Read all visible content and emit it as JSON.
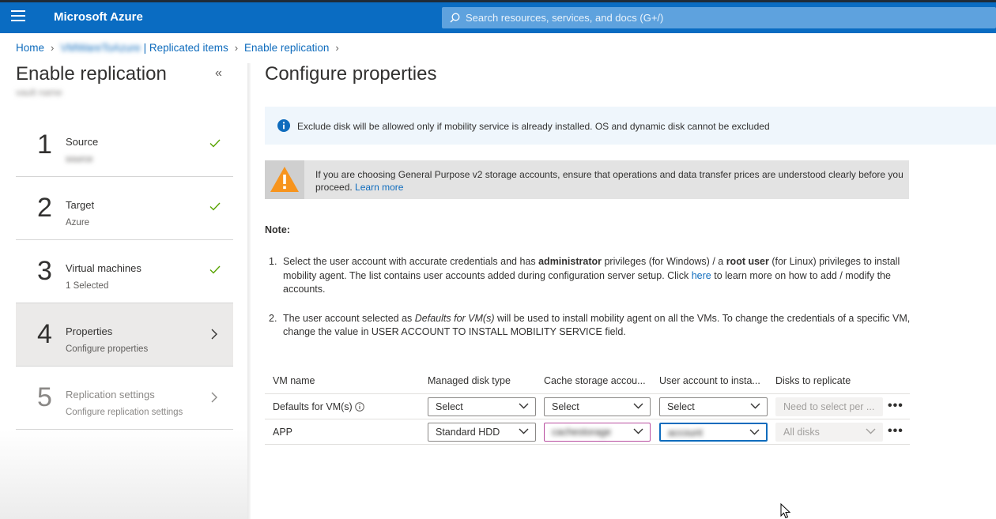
{
  "topbar": {
    "brand": "Microsoft Azure",
    "search_placeholder": "Search resources, services, and docs (G+/)"
  },
  "breadcrumb": {
    "home": "Home",
    "vault_blurred": "VMWareToAzure",
    "replicated_items": " | Replicated items",
    "enable_replication": "Enable replication"
  },
  "left": {
    "title": "Enable replication",
    "subtitle_blurred": "vault name",
    "steps": [
      {
        "num": "1",
        "title": "Source",
        "sub": "source",
        "state": "done"
      },
      {
        "num": "2",
        "title": "Target",
        "sub": "Azure",
        "state": "done"
      },
      {
        "num": "3",
        "title": "Virtual machines",
        "sub": "1 Selected",
        "state": "done"
      },
      {
        "num": "4",
        "title": "Properties",
        "sub": "Configure properties",
        "state": "active"
      },
      {
        "num": "5",
        "title": "Replication settings",
        "sub": "Configure replication settings",
        "state": "disabled"
      }
    ]
  },
  "main": {
    "title": "Configure properties",
    "info": "Exclude disk will be allowed only if mobility service is already installed. OS and dynamic disk cannot be excluded",
    "warning": "If you are choosing General Purpose v2 storage accounts, ensure that operations and data transfer prices are understood clearly before you proceed.",
    "warning_link": "Learn more",
    "note_heading": "Note:",
    "notes": {
      "n1_num": "1.",
      "n1_a": "Select the user account with accurate credentials and has ",
      "n1_b": "administrator",
      "n1_c": " privileges (for Windows) / a ",
      "n1_d": "root user",
      "n1_e": " (for Linux) privileges to install mobility agent. The list contains user accounts added during configuration server setup. Click ",
      "n1_link": "here",
      "n1_f": " to learn more on how to add / modify the accounts.",
      "n2_num": "2.",
      "n2_a": "The user account selected as ",
      "n2_b": "Defaults for VM(s)",
      "n2_c": " will be used to install mobility agent on all the VMs. To change the credentials of a specific VM, change the value in USER ACCOUNT TO INSTALL MOBILITY SERVICE field."
    },
    "grid": {
      "headers": [
        "VM name",
        "Managed disk type",
        "Cache storage accou...",
        "User account to insta...",
        "Disks to replicate"
      ],
      "rows": [
        {
          "name": "Defaults for VM(s)",
          "disk_type": "Select",
          "cache": "Select",
          "account": "Select",
          "disks": "Need to select per ..."
        },
        {
          "name": "APP",
          "disk_type": "Standard HDD",
          "cache": "cachestorage",
          "account": "account",
          "disks": "All disks"
        }
      ]
    }
  }
}
